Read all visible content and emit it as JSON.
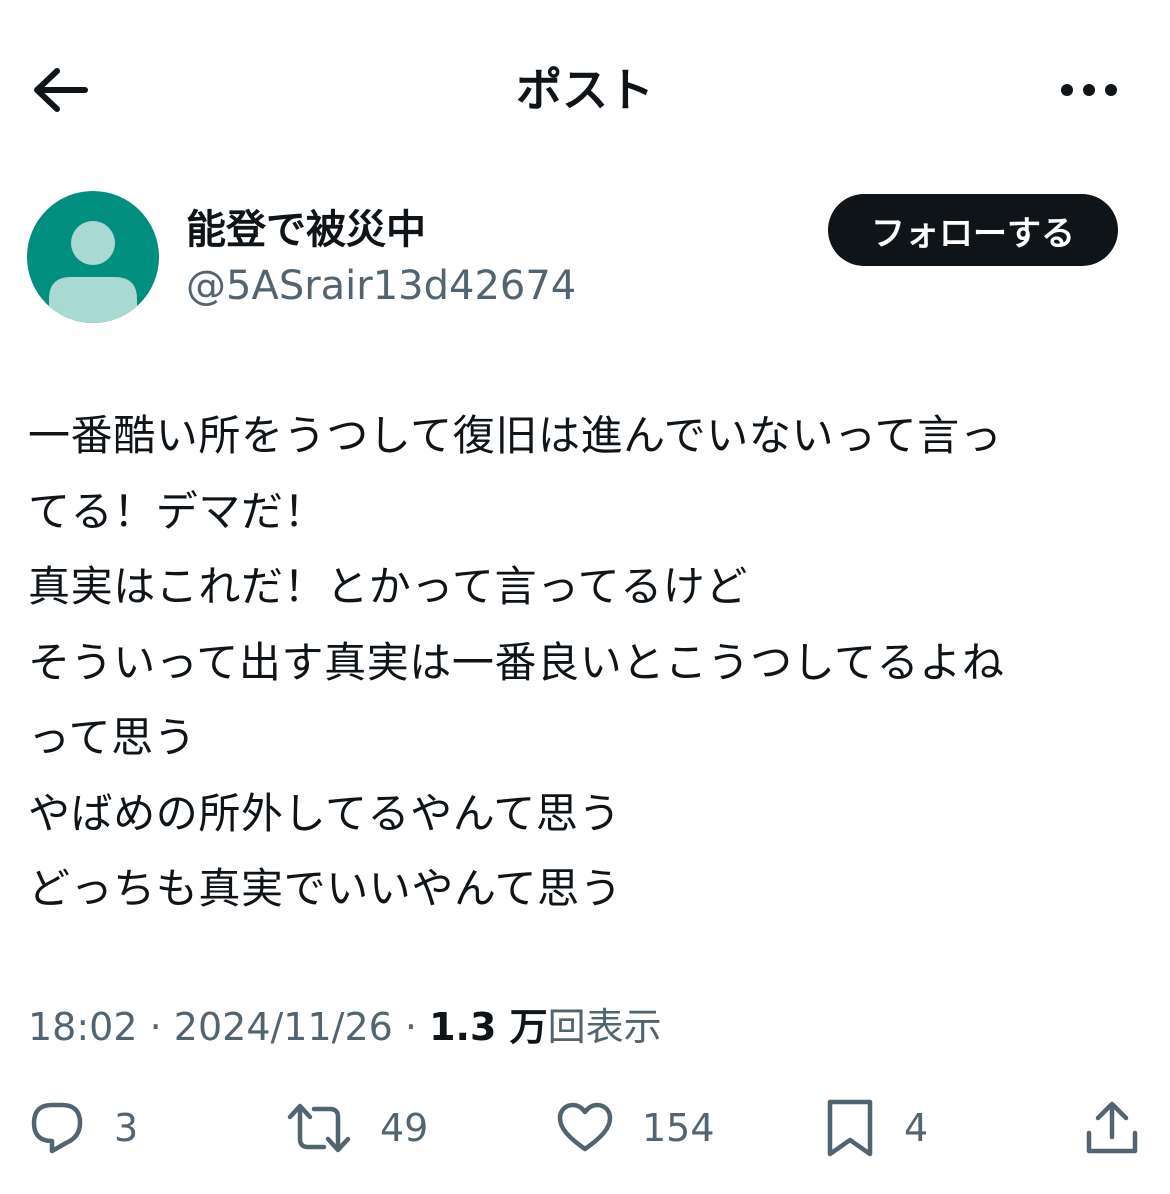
{
  "header": {
    "title": "ポスト",
    "back_icon": "arrow-left-icon",
    "more_icon": "more-horizontal-icon"
  },
  "author": {
    "display_name": "能登で被災中",
    "handle": "@5ASrair13d42674",
    "follow_label": "フォローする",
    "avatar_icon": "default-avatar-icon",
    "avatar_color": "#008e7f"
  },
  "tweet": {
    "lines": [
      "一番酷い所をうつして復旧は進んでいないって言っ",
      "てる！デマだ！",
      "真実はこれだ！とかって言ってるけど",
      "そういって出す真実は一番良いとこうつしてるよね",
      "って思う",
      "やばめの所外してるやんて思う",
      "どっちも真実でいいやんて思う"
    ]
  },
  "meta": {
    "time": "18:02",
    "separator": "·",
    "date": "2024/11/26",
    "views_count": "1.3 万",
    "views_label": "回表示"
  },
  "actions": {
    "replies": "3",
    "reposts": "49",
    "likes": "154",
    "bookmarks": "4"
  },
  "colors": {
    "text": "#0f1419",
    "secondary": "#536471",
    "follow_bg": "#0f1419"
  }
}
